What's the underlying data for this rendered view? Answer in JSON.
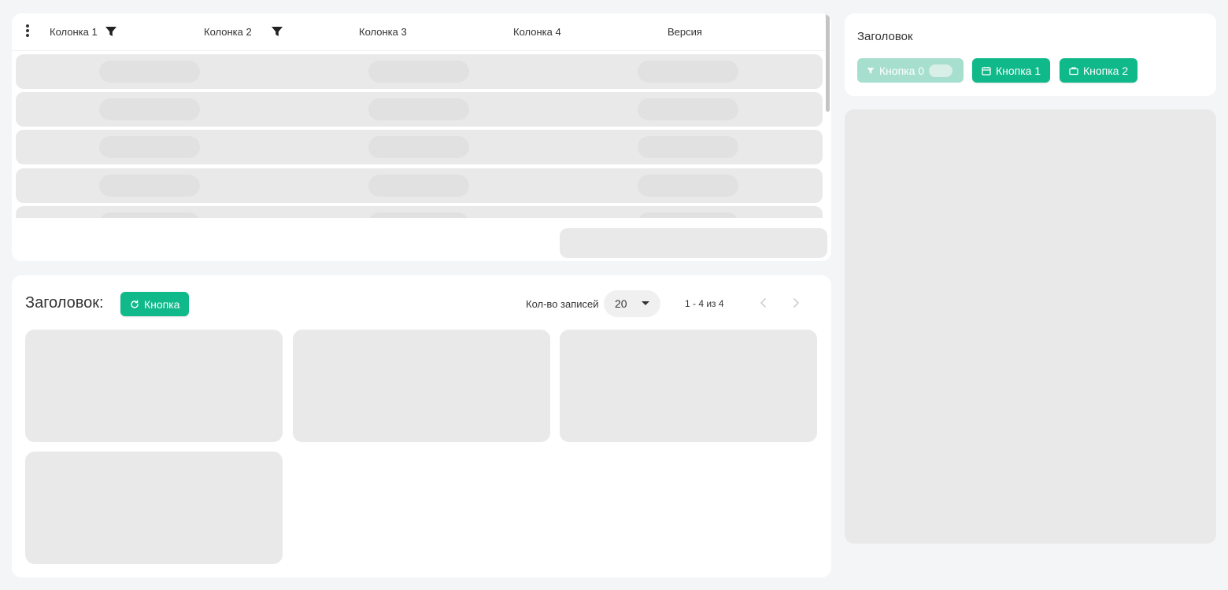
{
  "table": {
    "columns": [
      {
        "label": "Колонка 1",
        "filter_icon": "filter-icon"
      },
      {
        "label": "Колонка 2",
        "filter_icon": "filter-icon"
      },
      {
        "label": "Колонка 3"
      },
      {
        "label": "Колонка 4"
      },
      {
        "label": "Версия"
      }
    ],
    "menu_icon": "more-vertical-icon",
    "loading_rows": 5,
    "state": "loading"
  },
  "cards_section": {
    "title": "Заголовок:",
    "refresh_button": {
      "label": "Кнопка",
      "icon": "refresh-icon"
    },
    "records_label": "Кол-во записей",
    "records_per_page": "20",
    "range_text": "1 - 4 из 4",
    "prev_icon": "chevron-left-icon",
    "next_icon": "chevron-right-icon",
    "card_count": 4
  },
  "right_panel": {
    "title": "Заголовок",
    "buttons": [
      {
        "label": "Кнопка 0",
        "icon": "filter-icon",
        "state": "disabled"
      },
      {
        "label": "Кнопка 1",
        "icon": "calendar-icon"
      },
      {
        "label": "Кнопка 2",
        "icon": "briefcase-icon"
      }
    ]
  },
  "colors": {
    "accent": "#10b98a",
    "accent_disabled": "#a6dfcd",
    "background": "#f4f5f7",
    "skeleton": "#e9e9e9"
  }
}
